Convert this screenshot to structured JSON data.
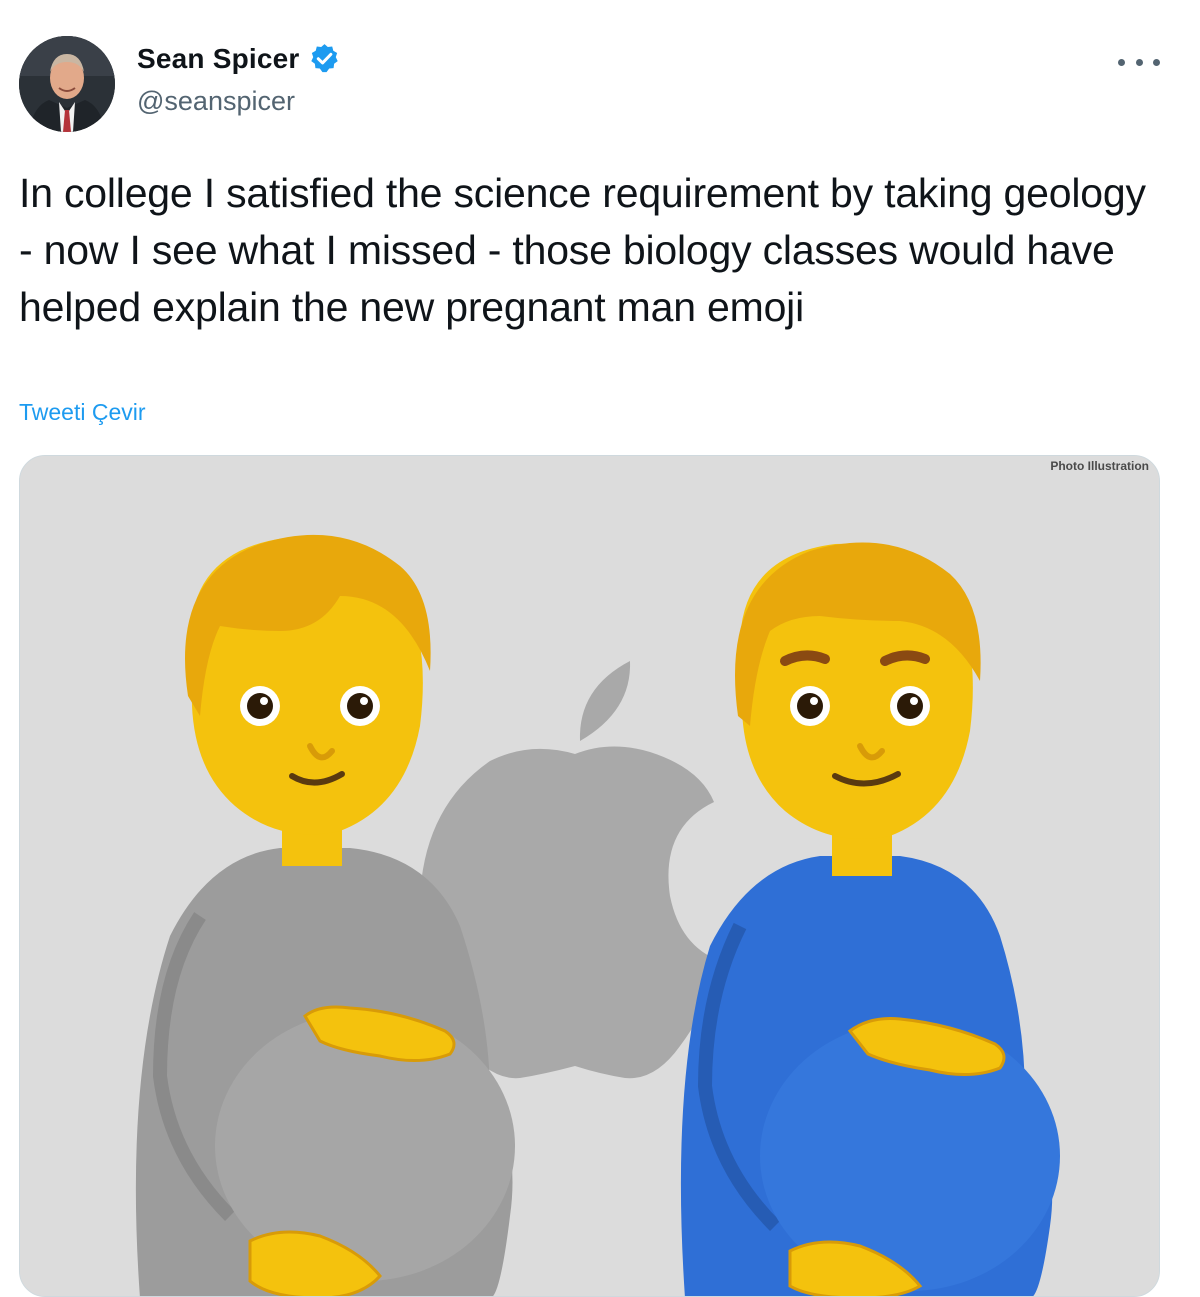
{
  "author": {
    "display_name": "Sean Spicer",
    "handle": "@seanspicer",
    "verified": true,
    "avatar_icon": "profile-photo"
  },
  "more_icon": "more-horizontal-icon",
  "tweet": {
    "text": "In college I satisfied the science requirement by taking geology - now I see what I missed - those biology classes would have helped explain the new pregnant man emoji",
    "translate_label": "Tweeti Çevir"
  },
  "media": {
    "credit": "Photo Illustration",
    "content": "two pregnant emoji figures in front of an apple logo",
    "colors": {
      "background": "#dcdcdc",
      "logo": "#a9a9a9",
      "skin": "#f4c20d",
      "hair": "#e8a80c",
      "gray_shirt": "#9c9c9c",
      "blue_shirt": "#2f6fd6"
    }
  },
  "colors": {
    "accent": "#1d9bf0",
    "text": "#0f1419",
    "muted": "#536471"
  }
}
